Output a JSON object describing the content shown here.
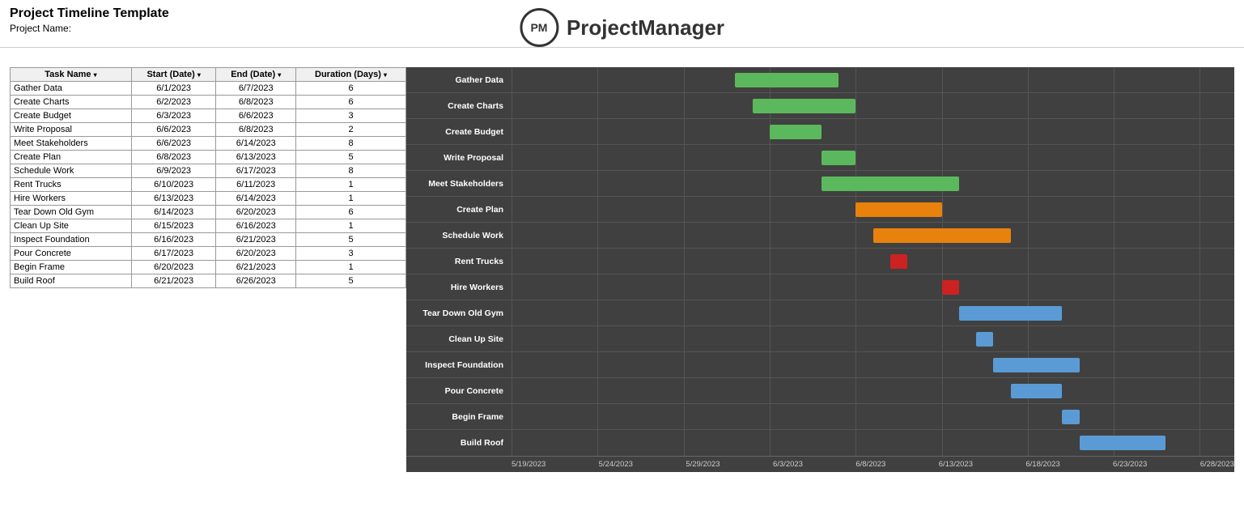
{
  "header": {
    "title": "Project Timeline Template",
    "project_name_label": "Project Name:",
    "logo_initials": "PM",
    "logo_text": "ProjectManager"
  },
  "table": {
    "columns": [
      {
        "label": "Task Name",
        "has_filter": true
      },
      {
        "label": "Start (Date)",
        "has_filter": true
      },
      {
        "label": "End  (Date)",
        "has_filter": true
      },
      {
        "label": "Duration (Days)",
        "has_filter": true
      }
    ],
    "rows": [
      {
        "task": "Gather Data",
        "start": "6/1/2023",
        "end": "6/7/2023",
        "duration": 6
      },
      {
        "task": "Create Charts",
        "start": "6/2/2023",
        "end": "6/8/2023",
        "duration": 6
      },
      {
        "task": "Create Budget",
        "start": "6/3/2023",
        "end": "6/6/2023",
        "duration": 3
      },
      {
        "task": "Write Proposal",
        "start": "6/6/2023",
        "end": "6/8/2023",
        "duration": 2
      },
      {
        "task": "Meet Stakeholders",
        "start": "6/6/2023",
        "end": "6/14/2023",
        "duration": 8
      },
      {
        "task": "Create Plan",
        "start": "6/8/2023",
        "end": "6/13/2023",
        "duration": 5
      },
      {
        "task": "Schedule Work",
        "start": "6/9/2023",
        "end": "6/17/2023",
        "duration": 8
      },
      {
        "task": "Rent Trucks",
        "start": "6/10/2023",
        "end": "6/11/2023",
        "duration": 1
      },
      {
        "task": "Hire Workers",
        "start": "6/13/2023",
        "end": "6/14/2023",
        "duration": 1
      },
      {
        "task": "Tear Down Old Gym",
        "start": "6/14/2023",
        "end": "6/20/2023",
        "duration": 6
      },
      {
        "task": "Clean Up Site",
        "start": "6/15/2023",
        "end": "6/16/2023",
        "duration": 1
      },
      {
        "task": "Inspect Foundation",
        "start": "6/16/2023",
        "end": "6/21/2023",
        "duration": 5
      },
      {
        "task": "Pour Concrete",
        "start": "6/17/2023",
        "end": "6/20/2023",
        "duration": 3
      },
      {
        "task": "Begin Frame",
        "start": "6/20/2023",
        "end": "6/21/2023",
        "duration": 1
      },
      {
        "task": "Build Roof",
        "start": "6/21/2023",
        "end": "6/26/2023",
        "duration": 5
      }
    ]
  },
  "gantt": {
    "x_axis_labels": [
      "5/19/2023",
      "5/24/2023",
      "5/29/2023",
      "6/3/2023",
      "6/8/2023",
      "6/13/2023",
      "6/18/2023",
      "6/23/2023",
      "6/28/2023"
    ],
    "chart_start_date": "2023-05-19",
    "chart_end_date": "2023-06-30",
    "bars": [
      {
        "task": "Gather Data",
        "start": "2023-06-01",
        "end": "2023-06-07",
        "color": "green"
      },
      {
        "task": "Create Charts",
        "start": "2023-06-02",
        "end": "2023-06-08",
        "color": "green"
      },
      {
        "task": "Create Budget",
        "start": "2023-06-03",
        "end": "2023-06-06",
        "color": "green"
      },
      {
        "task": "Write Proposal",
        "start": "2023-06-06",
        "end": "2023-06-08",
        "color": "green"
      },
      {
        "task": "Meet Stakeholders",
        "start": "2023-06-06",
        "end": "2023-06-14",
        "color": "green"
      },
      {
        "task": "Create Plan",
        "start": "2023-06-08",
        "end": "2023-06-13",
        "color": "orange"
      },
      {
        "task": "Schedule Work",
        "start": "2023-06-09",
        "end": "2023-06-17",
        "color": "orange"
      },
      {
        "task": "Rent Trucks",
        "start": "2023-06-10",
        "end": "2023-06-11",
        "color": "red"
      },
      {
        "task": "Hire Workers",
        "start": "2023-06-13",
        "end": "2023-06-14",
        "color": "red"
      },
      {
        "task": "Tear Down Old Gym",
        "start": "2023-06-14",
        "end": "2023-06-20",
        "color": "blue"
      },
      {
        "task": "Clean Up Site",
        "start": "2023-06-15",
        "end": "2023-06-16",
        "color": "blue"
      },
      {
        "task": "Inspect Foundation",
        "start": "2023-06-16",
        "end": "2023-06-21",
        "color": "blue"
      },
      {
        "task": "Pour Concrete",
        "start": "2023-06-17",
        "end": "2023-06-20",
        "color": "blue"
      },
      {
        "task": "Begin Frame",
        "start": "2023-06-20",
        "end": "2023-06-21",
        "color": "blue"
      },
      {
        "task": "Build Roof",
        "start": "2023-06-21",
        "end": "2023-06-26",
        "color": "blue"
      }
    ]
  }
}
